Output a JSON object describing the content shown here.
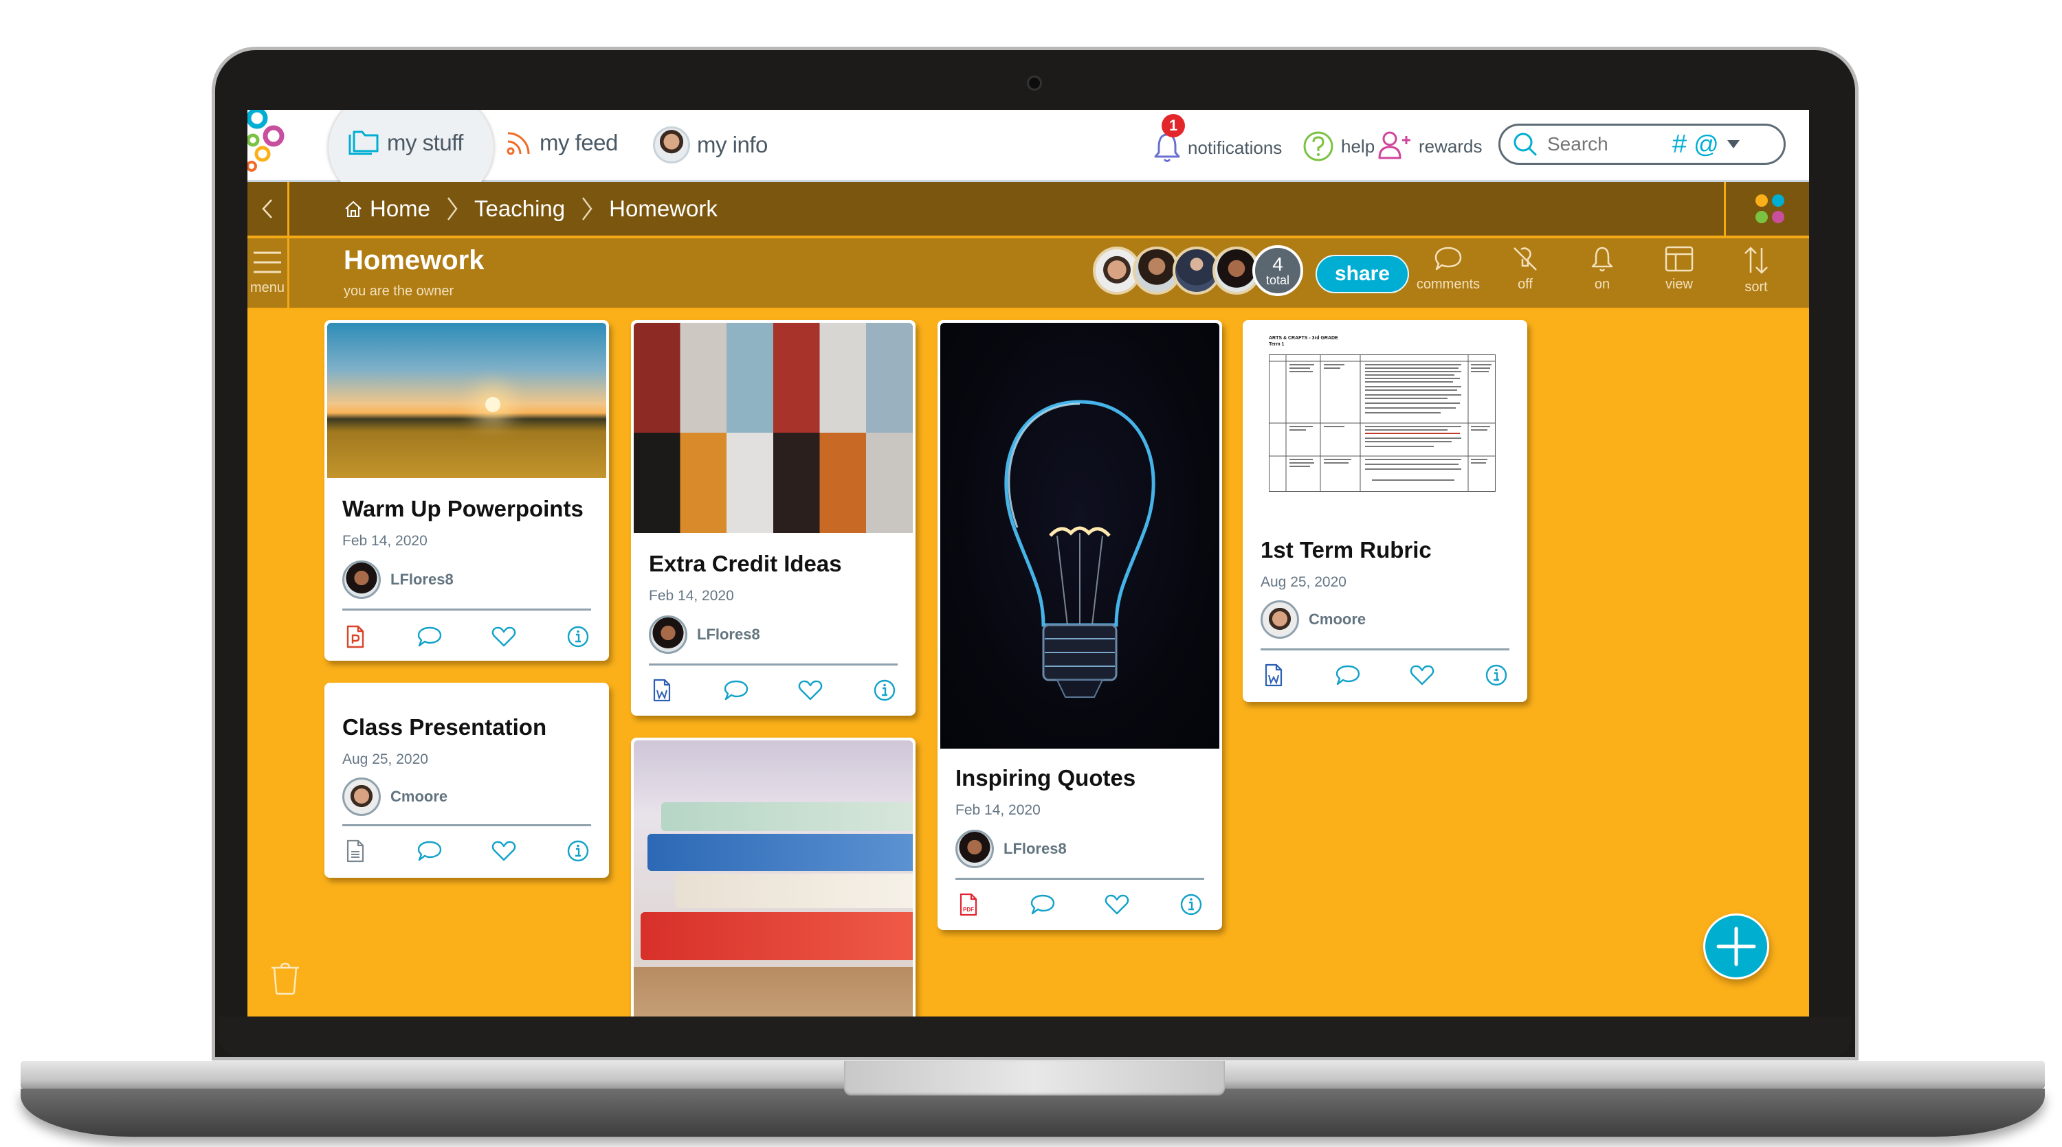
{
  "nav": {
    "tabs": [
      {
        "label": "my stuff",
        "icon": "folder-icon",
        "active": true
      },
      {
        "label": "my feed",
        "icon": "rss-icon"
      },
      {
        "label": "my info",
        "icon": "avatar"
      }
    ],
    "notifications": {
      "label": "notifications",
      "count": "1"
    },
    "help": {
      "label": "help"
    },
    "rewards": {
      "label": "rewards"
    },
    "search": {
      "placeholder": "Search",
      "hashtag": "#",
      "mention": "@"
    }
  },
  "breadcrumb": {
    "items": [
      "Home",
      "Teaching",
      "Homework"
    ]
  },
  "header": {
    "menu_label": "menu",
    "title": "Homework",
    "subtitle": "you are the owner",
    "members_total_count": "4",
    "members_total_label": "total",
    "share_label": "share",
    "tools": [
      {
        "label": "comments",
        "icon": "comment-icon"
      },
      {
        "label": "off",
        "icon": "pin-off-icon"
      },
      {
        "label": "on",
        "icon": "bell-icon"
      },
      {
        "label": "view",
        "icon": "layout-icon"
      },
      {
        "label": "sort",
        "icon": "sort-icon"
      }
    ]
  },
  "cards": [
    {
      "title": "Warm Up Powerpoints",
      "date": "Feb 14, 2020",
      "author": "LFlores8",
      "file_type": "powerpoint",
      "image": "sunset-field"
    },
    {
      "title": "Class Presentation",
      "date": "Aug 25, 2020",
      "author": "Cmoore",
      "file_type": "document",
      "image": "none"
    },
    {
      "title": "Extra Credit Ideas",
      "date": "Feb 14, 2020",
      "author": "LFlores8",
      "file_type": "word",
      "image": "lockers"
    },
    {
      "title": "",
      "date": "",
      "author": "",
      "file_type": "",
      "image": "stacked-books"
    },
    {
      "title": "Inspiring Quotes",
      "date": "Feb 14, 2020",
      "author": "LFlores8",
      "file_type": "pdf",
      "image": "light-bulb"
    },
    {
      "title": "1st Term Rubric",
      "date": "Aug 25, 2020",
      "author": "Cmoore",
      "file_type": "word",
      "image": "rubric-document"
    }
  ],
  "rubric_preview": {
    "heading": "ARTS & CRAFTS - 3rd GRADE",
    "subheading": "Term 1",
    "columns": [
      "",
      "Objectives",
      "Activity",
      "Detail",
      "Material"
    ]
  },
  "colors": {
    "content_bg": "#fbb01a",
    "breadcrumb_bg": "#7b560f",
    "titlebar_bg": "#b07c14",
    "accent": "#00aed3",
    "badge": "#e3262a"
  }
}
